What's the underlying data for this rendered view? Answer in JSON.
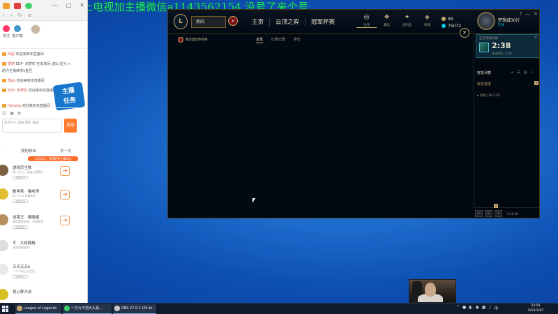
{
  "overlay": {
    "text": "上电视加主播微信a1143562154 没号了来个号"
  },
  "chat_panel": {
    "toolbar": {
      "back": "‹",
      "forward": "›",
      "refresh": "↻",
      "more": "≡"
    },
    "window_controls": {
      "minimize": "—",
      "maximize": "□",
      "close": "✕"
    },
    "header": {
      "follow": "关注",
      "client": "客户端"
    },
    "feed": [
      {
        "name": "风起",
        "text": "欢迎来到本直播间"
      },
      {
        "name": "感谢",
        "text": "EDP· 米梦蛇 在本房间 送出 星光 ×"
      },
      {
        "name": "",
        "text": "助力主播获得1金豆"
      },
      {
        "name": "雪pk",
        "text": "欢迎来到本直播间"
      },
      {
        "name": "EDP· 米梦蛇",
        "text": "欢迎来到本直播间"
      },
      {
        "name": "Hehehe",
        "text": "欢迎来到本直播间"
      }
    ],
    "banner": {
      "line1": "主播",
      "line2": "任务"
    },
    "input": {
      "placeholder": "说点什么 或按 回车 发送",
      "send": "发送"
    },
    "fans": {
      "title": "我的粉丝",
      "refresh": "换一批",
      "hint": "点击关注，获得更多主播动态",
      "items": [
        {
          "name": "虐网宗主陈",
          "desc": "独一无二，无敌之国家队",
          "tag": "互相关注"
        },
        {
          "name": "数学系 · 猫老师",
          "desc": "Dr—u-ki 你喜欢吗",
          "tag": "互相关注"
        },
        {
          "name": "韭菜王 · 嗑嗑嗑",
          "desc": "我们都是韭菜，不如享受",
          "tag": "互相关注"
        },
        {
          "name": "芊 · 大叔梅梅",
          "desc": "欢迎来到这里",
          "tag": ""
        },
        {
          "name": "天天天天h",
          "desc": "一个人的上分生活",
          "tag": "互相关注"
        },
        {
          "name": "良心胖大叔",
          "desc": "",
          "tag": ""
        }
      ]
    }
  },
  "lol": {
    "logo": "L",
    "play_button": "房间",
    "close_party": "✕",
    "nav": [
      "主页",
      "云顶之弈",
      "冠军杯赛"
    ],
    "icons": [
      {
        "glyph": "◎",
        "label": "生涯"
      },
      {
        "glyph": "❖",
        "label": "藏品"
      },
      {
        "glyph": "✦",
        "label": "战利品"
      },
      {
        "glyph": "◈",
        "label": "商城"
      }
    ],
    "currency": {
      "be_color": "#c8aa6e",
      "rp_color": "#0acbe6",
      "be": "99",
      "rp": "75072"
    },
    "profile": {
      "name": "梦想减30斤",
      "status": "在线"
    },
    "window_controls": {
      "help": "?",
      "minimize": "—",
      "close": "✕"
    },
    "sub": {
      "room": "我可喜欢你的呀",
      "tabs": [
        "总览",
        "比赛记录",
        "排位"
      ]
    },
    "queue": {
      "title": "正在寻找对局",
      "timer": "2:38",
      "estimate": "估计时间 : 0:32",
      "close": "✕"
    },
    "friends": {
      "title": "好友列表",
      "icons": [
        "+",
        "☰",
        "▤",
        "⌕"
      ],
      "requests_label": "好友请求",
      "requests_count": "2",
      "group": "▸ 常规 (16/372)"
    },
    "bottombar": {
      "chat": "▭",
      "mission": "☰",
      "mute": "♪",
      "time": "0:12:18",
      "badge": "2"
    },
    "overlay_close": "✕"
  },
  "taskbar": {
    "items": [
      {
        "label": "League of Legends",
        "color": "#c8aa6e"
      },
      {
        "label": "一万九千把大头嘉...",
        "color": "#3dd06a"
      },
      {
        "label": "OBS 27.0.1 (64-bi...",
        "color": "#cccccc"
      }
    ],
    "tray": [
      "⌃",
      "●",
      "◐",
      "◉",
      "▦",
      "♪",
      "中"
    ],
    "time": "23:50",
    "date": "2021/10/7"
  }
}
